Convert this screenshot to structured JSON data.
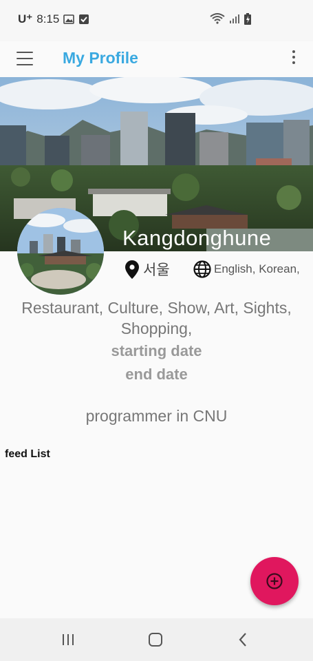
{
  "status_bar": {
    "carrier": "U⁺",
    "time": "8:15"
  },
  "app_bar": {
    "title": "My Profile"
  },
  "profile": {
    "name": "Kangdonghune",
    "location": "서울",
    "languages": "English, Korean,",
    "interests": "Restaurant, Culture, Show, Art, Sights, Shopping,",
    "starting_date": "starting date",
    "end_date": "end date",
    "occupation": "programmer in  CNU"
  },
  "feed": {
    "label": "feed List"
  },
  "colors": {
    "title_blue": "#3aa9e0",
    "fab_pink": "#e0175e"
  },
  "icons": {
    "menu": "hamburger-menu-icon",
    "overflow": "more-vert-icon",
    "location": "location-pin-icon",
    "languages": "globe-icon",
    "fab": "add-circle-icon"
  }
}
